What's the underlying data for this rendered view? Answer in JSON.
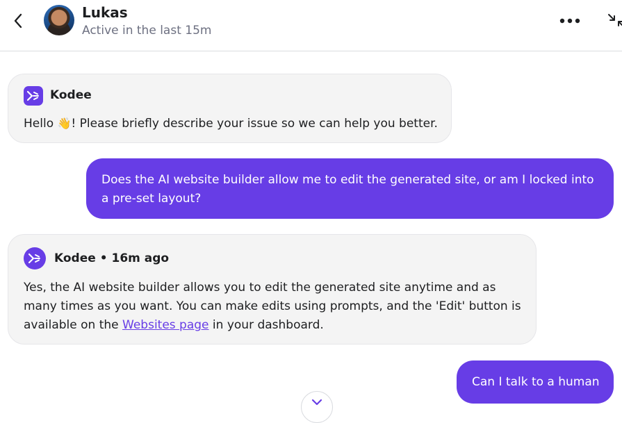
{
  "header": {
    "name": "Lukas",
    "status": "Active in the last 15m"
  },
  "messages": {
    "m1": {
      "sender": "Kodee",
      "text_before": "Hello ",
      "emoji": "👋",
      "text_after": "! Please briefly describe your issue so we can help you better."
    },
    "m2": {
      "text": "Does the AI website builder allow me to edit the generated site, or am I locked into a pre-set layout?"
    },
    "m3": {
      "sender": "Kodee",
      "separator": " • ",
      "time": "16m ago",
      "text_before": "Yes, the AI website builder allows you to edit the generated site anytime and as many times as you want. You can make edits using prompts, and the 'Edit' button is available on the ",
      "link": "Websites page",
      "text_after": " in your dashboard."
    },
    "m4": {
      "text": "Can I talk to a human"
    }
  },
  "colors": {
    "accent": "#673de6",
    "incoming_bubble": "#f4f4f4",
    "muted_text": "#6d7081"
  },
  "icons": {
    "back": "chevron-left-icon",
    "more": "more-horizontal-icon",
    "collapse": "collapse-icon",
    "bot": "kodee-logo-icon",
    "scroll": "chevron-down-icon"
  }
}
